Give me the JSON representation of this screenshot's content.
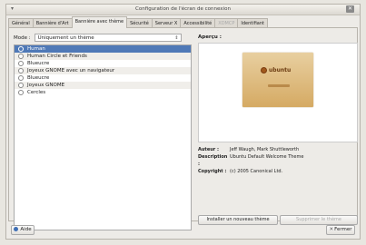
{
  "window": {
    "title": "Configuration de l'écran de connexion",
    "menu_glyph": "▾",
    "close_glyph": "✕"
  },
  "tabs": [
    {
      "label": "Général",
      "active": false,
      "disabled": false
    },
    {
      "label": "Bannière d'Art",
      "active": false,
      "disabled": false
    },
    {
      "label": "Bannière avec thème",
      "active": true,
      "disabled": false
    },
    {
      "label": "Sécurité",
      "active": false,
      "disabled": false
    },
    {
      "label": "Serveur X",
      "active": false,
      "disabled": false
    },
    {
      "label": "Accessibilité",
      "active": false,
      "disabled": false
    },
    {
      "label": "XDMCP",
      "active": false,
      "disabled": true
    },
    {
      "label": "Identifiant",
      "active": false,
      "disabled": false
    }
  ],
  "mode": {
    "label": "Mode :",
    "value": "Uniquement un thème",
    "arrow": "⇕"
  },
  "themes": [
    {
      "name": "Human",
      "selected": true
    },
    {
      "name": "Human Circle et Friends",
      "selected": false
    },
    {
      "name": "Blueucre",
      "selected": false
    },
    {
      "name": "Joyeux GNOME avec un navigateur",
      "selected": false
    },
    {
      "name": "Blueucre",
      "selected": false
    },
    {
      "name": "Joyeux GNOME",
      "selected": false
    },
    {
      "name": "Cercles",
      "selected": false
    }
  ],
  "preview": {
    "label": "Aperçu :",
    "logo_text": "ubuntu"
  },
  "info": [
    {
      "key": "Auteur :",
      "value": "Jeff Waugh, Mark Shuttleworth"
    },
    {
      "key": "Description :",
      "value": "Ubuntu Default Welcome Theme"
    },
    {
      "key": "Copyright :",
      "value": "(c) 2005 Canonical Ltd."
    }
  ],
  "buttons": {
    "install": "Installer un nouveau thème",
    "remove": "Supprimer le thème",
    "help": "Aide",
    "close": "Fermer",
    "close_glyph": "✕"
  },
  "colors": {
    "selection": "#4f79b7",
    "window_bg": "#edebe7"
  }
}
